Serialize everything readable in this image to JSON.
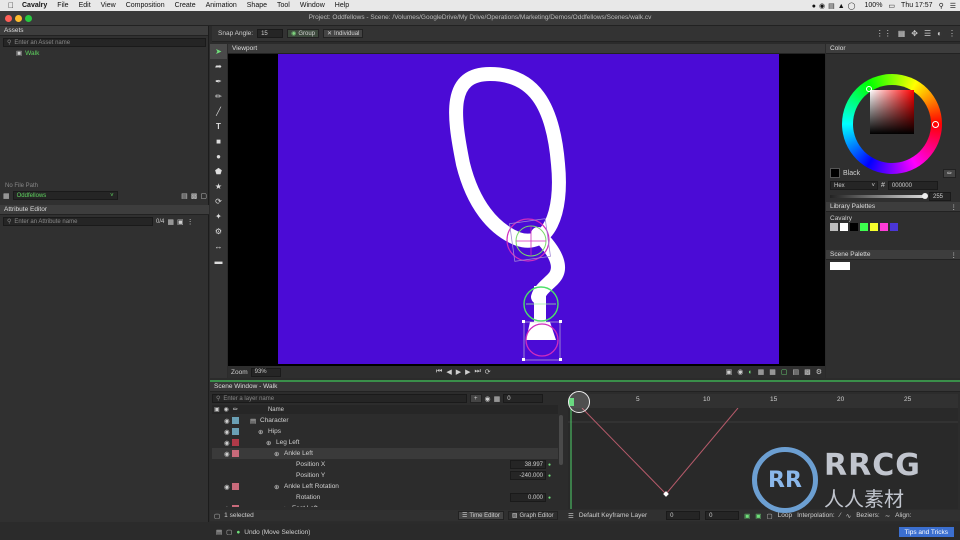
{
  "menubar": {
    "app": "Cavalry",
    "items": [
      "File",
      "Edit",
      "View",
      "Composition",
      "Create",
      "Animation",
      "Shape",
      "Tool",
      "Window",
      "Help"
    ],
    "battery": "100%",
    "clock": "Thu 17:57"
  },
  "window": {
    "title": "Project: Oddfellows - Scene: /Volumes/GoogleDrive/My Drive/Operations/Marketing/Demos/Oddfellows/Scenes/walk.cv"
  },
  "toolbar": {
    "snap_label": "Snap Angle:",
    "snap_value": "15",
    "group_label": "Group",
    "individual_label": "Individual"
  },
  "assets": {
    "header": "Assets",
    "search_placeholder": "Enter an Asset name",
    "items": [
      "Walk"
    ],
    "file_path": "No File Path",
    "project": "Oddfellows"
  },
  "attribute_editor": {
    "header": "Attribute Editor",
    "search_placeholder": "Enter an Attribute name",
    "count": "0/4"
  },
  "viewport": {
    "header": "Viewport",
    "zoom_label": "Zoom",
    "zoom_value": "93%",
    "bg_color": "#4b0bd6"
  },
  "color_panel": {
    "header": "Color",
    "color_name": "Black",
    "mode": "Hex",
    "hex_value": "000000",
    "alpha": "255",
    "library_header": "Library Palettes",
    "library_name": "Cavalry",
    "library_swatches": [
      "#bdbdbd",
      "#ffffff",
      "#000000",
      "#3cff4e",
      "#f6ff2c",
      "#ff3bd8",
      "#4a36d8"
    ],
    "scene_header": "Scene Palette",
    "scene_swatches": [
      "#ffffff"
    ]
  },
  "scene_window": {
    "header": "Scene Window - Walk",
    "search_placeholder": "Enter a layer name",
    "frame": "0",
    "column_name": "Name",
    "layers": [
      {
        "name": "Character",
        "color": "#6aa0b5"
      },
      {
        "name": "Hips",
        "color": "#6aa0b5"
      },
      {
        "name": "Leg Left",
        "color": "#b03a48"
      },
      {
        "name": "Ankle Left",
        "color": "#c86a7a"
      },
      {
        "name": "Position X",
        "value": "38.997"
      },
      {
        "name": "Position Y",
        "value": "-240.000"
      },
      {
        "name": "Ankle Left Rotation",
        "color": "#c86a7a"
      },
      {
        "name": "Rotation",
        "value": "0.000"
      },
      {
        "name": "Foot Left",
        "color": "#c86a7a"
      }
    ],
    "selected_count": "1 selected",
    "time_editor": "Time Editor",
    "graph_editor": "Graph Editor",
    "keyframe_layer": "Default Keyframe Layer",
    "field_a": "0",
    "field_b": "0",
    "loop": "Loop",
    "interpolation": "Interpolation:",
    "beziers": "Beziers:",
    "align": "Align:",
    "ruler": [
      "5",
      "10",
      "15",
      "20",
      "25"
    ]
  },
  "status": {
    "undo": "Undo (Move Selection)",
    "tips": "Tips and Tricks"
  },
  "watermark": {
    "brand": "RRCG",
    "sub": "人人素材"
  }
}
